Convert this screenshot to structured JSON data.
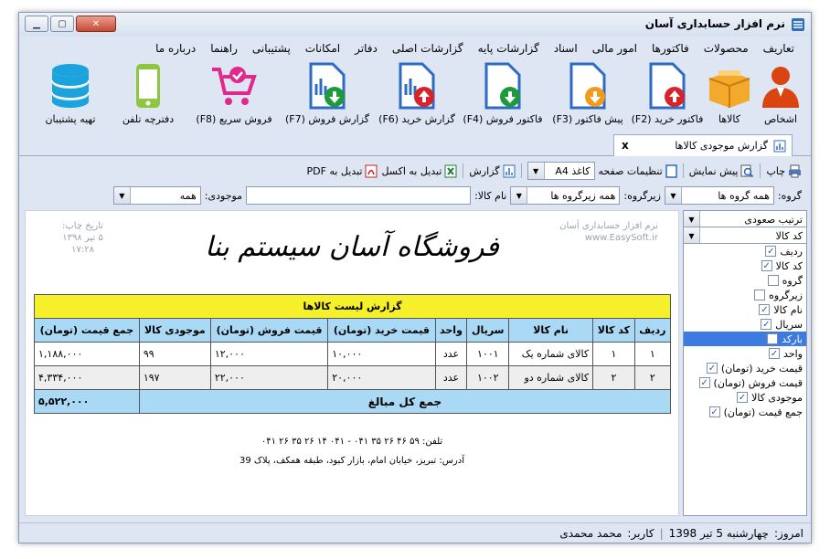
{
  "window": {
    "title": "نرم افزار حسابداری آسان"
  },
  "menu": [
    "تعاریف",
    "محصولات",
    "فاکتورها",
    "امور مالی",
    "اسناد",
    "گزارشات پایه",
    "گزارشات اصلی",
    "دفاتر",
    "امکانات",
    "پشتیبانی",
    "راهنما",
    "درباره ما"
  ],
  "ribbon": [
    {
      "label": "اشخاص",
      "icon": "person-icon"
    },
    {
      "label": "کالاها",
      "icon": "box-icon"
    },
    {
      "label": "فاکتور خرید (F2)",
      "icon": "invoice-up-icon"
    },
    {
      "label": "پیش فاکتور (F3)",
      "icon": "invoice-down-orange-icon"
    },
    {
      "label": "فاکتور فروش (F4)",
      "icon": "invoice-down-green-icon"
    },
    {
      "label": "گزارش خرید (F6)",
      "icon": "report-up-icon"
    },
    {
      "label": "گزارش فروش (F7)",
      "icon": "report-down-icon"
    },
    {
      "label": "فروش سریع (F8)",
      "icon": "cart-icon"
    },
    {
      "label": "دفترچه تلفن",
      "icon": "phone-icon"
    },
    {
      "label": "تهیه پشتیبان",
      "icon": "database-icon"
    }
  ],
  "tab": {
    "label": "گزارش موجودی کالاها",
    "close": "x"
  },
  "toolbar": {
    "print": "چاپ",
    "preview": "پیش نمایش",
    "page_settings": "تنظیمات صفحه",
    "paper": "کاغذ A4",
    "report": "گزارش",
    "excel": "تبدیل به اکسل",
    "pdf": "تبدیل به PDF"
  },
  "filters": {
    "group_label": "گروه:",
    "group_value": "همه گروه ها",
    "subgroup_label": "زیرگروه:",
    "subgroup_value": "همه زیرگروه ها",
    "name_label": "نام کالا:",
    "name_value": "",
    "stock_label": "موجودی:",
    "stock_value": "همه"
  },
  "side": {
    "sort": "ترتیب صعودی",
    "sort_field": "کد کالا",
    "columns": [
      {
        "label": "ردیف",
        "checked": true
      },
      {
        "label": "کد کالا",
        "checked": true
      },
      {
        "label": "گروه",
        "checked": false
      },
      {
        "label": "زیرگروه",
        "checked": false
      },
      {
        "label": "نام کالا",
        "checked": true
      },
      {
        "label": "سریال",
        "checked": true
      },
      {
        "label": "بارکد",
        "checked": false,
        "selected": true
      },
      {
        "label": "واحد",
        "checked": true
      },
      {
        "label": "قیمت خرید (تومان)",
        "checked": true
      },
      {
        "label": "قیمت فروش (تومان)",
        "checked": true
      },
      {
        "label": "موجودی کالا",
        "checked": true
      },
      {
        "label": "جمع قیمت (تومان)",
        "checked": true
      }
    ]
  },
  "report": {
    "shop_name": "فروشگاه آسان سیستم بنا",
    "software": "نرم افزار حسابداری آسان",
    "website": "www.EasySoft.ir",
    "print_date_label": "تاریخ چاپ:",
    "print_date": "۵ تیر ۱۳۹۸",
    "print_time": "۱۷:۲۸",
    "caption": "گزارش لیست کالاها",
    "headers": [
      "ردیف",
      "کد کالا",
      "نام کالا",
      "سریال",
      "واحد",
      "قیمت خرید (تومان)",
      "قیمت فروش (تومان)",
      "موجودی کالا",
      "جمع قیمت (تومان)"
    ],
    "rows": [
      [
        "۱",
        "۱",
        "کالای شماره یک",
        "۱۰۰۱",
        "عدد",
        "۱۰,۰۰۰",
        "۱۲,۰۰۰",
        "۹۹",
        "۱,۱۸۸,۰۰۰"
      ],
      [
        "۲",
        "۲",
        "کالای شماره دو",
        "۱۰۰۲",
        "عدد",
        "۲۰,۰۰۰",
        "۲۲,۰۰۰",
        "۱۹۷",
        "۴,۳۳۴,۰۰۰"
      ]
    ],
    "total_label": "جمع کل مبالغ",
    "total_value": "۵,۵۲۲,۰۰۰",
    "phone": "تلفن: ۵۹ ۴۶ ۲۶ ۳۵ ۰۴۱ - ۰۴۱ ۱۴ ۲۶ ۳۵ ۲۶ ۰۴۱",
    "address": "آدرس: تبریز، خیابان امام، بازار کبود، طبقه همکف، پلاک 39"
  },
  "status": {
    "today_label": "امروز:",
    "today": "چهارشنبه 5 تیر 1398",
    "user_label": "کاربر:",
    "user": "محمد محمدی"
  }
}
